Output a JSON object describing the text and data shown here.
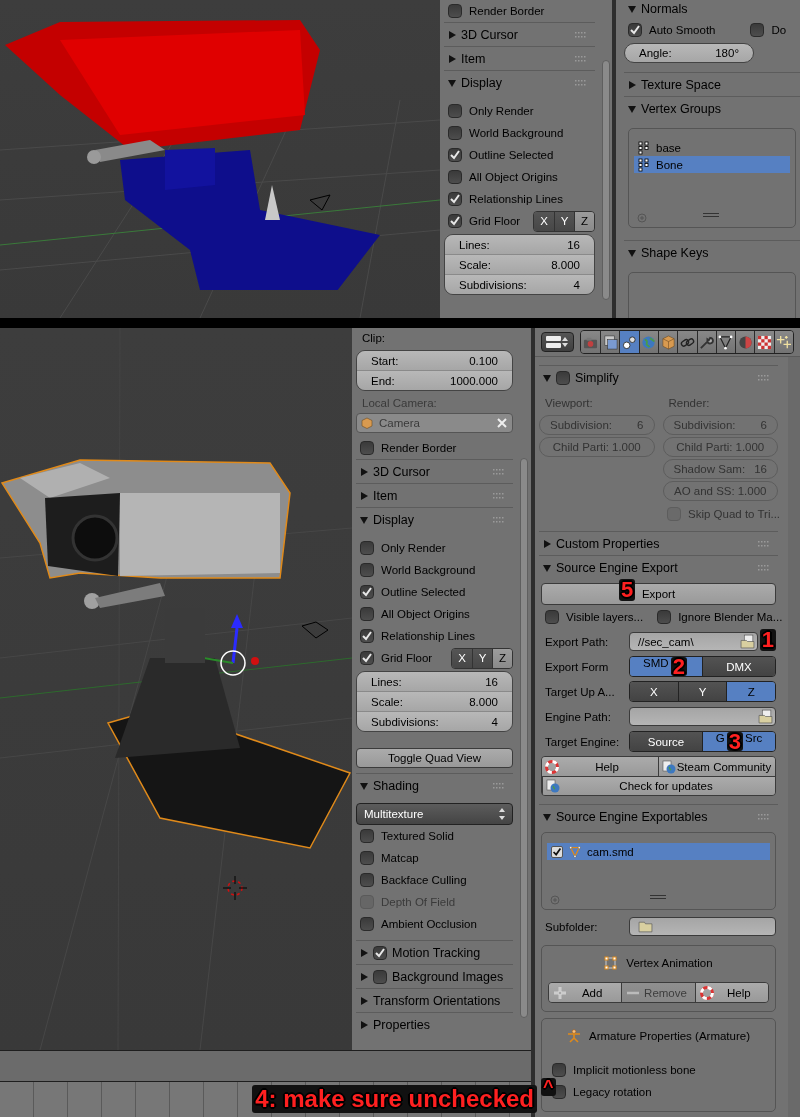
{
  "top": {
    "view_panel": {
      "render_border": {
        "label": "Render Border",
        "checked": false
      },
      "sections": [
        {
          "title": "3D Cursor",
          "expanded": false
        },
        {
          "title": "Item",
          "expanded": false
        },
        {
          "title": "Display",
          "expanded": true
        }
      ],
      "display_options": [
        {
          "label": "Only Render",
          "checked": false
        },
        {
          "label": "World Background",
          "checked": false
        },
        {
          "label": "Outline Selected",
          "checked": true
        },
        {
          "label": "All Object Origins",
          "checked": false
        },
        {
          "label": "Relationship Lines",
          "checked": true
        }
      ],
      "grid_floor": {
        "label": "Grid Floor",
        "checked": true,
        "axes": [
          {
            "label": "X",
            "selected": false
          },
          {
            "label": "Y",
            "selected": false
          },
          {
            "label": "Z",
            "selected": true
          }
        ]
      },
      "grid_fields": [
        {
          "label": "Lines:",
          "value": "16"
        },
        {
          "label": "Scale:",
          "value": "8.000"
        },
        {
          "label": "Subdivisions:",
          "value": "4"
        }
      ]
    },
    "data_panel": {
      "normals_title": "Normals",
      "auto_smooth": {
        "label": "Auto Smooth",
        "checked": true
      },
      "double_sided": {
        "label": "Do",
        "checked": false
      },
      "angle": {
        "label": "Angle:",
        "value": "180°"
      },
      "sections": [
        {
          "title": "Texture Space",
          "expanded": false
        },
        {
          "title": "Vertex Groups",
          "expanded": true
        }
      ],
      "vertex_groups": [
        {
          "name": "base",
          "selected": false
        },
        {
          "name": "Bone",
          "selected": true
        }
      ],
      "shape_keys": {
        "title": "Shape Keys",
        "expanded": true
      }
    }
  },
  "bottom": {
    "view_panel": {
      "clip": {
        "label": "Clip:",
        "fields": [
          {
            "label": "Start:",
            "value": "0.100"
          },
          {
            "label": "End:",
            "value": "1000.000"
          }
        ]
      },
      "local_camera": {
        "label": "Local Camera:",
        "value": "Camera",
        "disabled": true
      },
      "render_border": {
        "label": "Render Border",
        "checked": false
      },
      "sections": [
        {
          "title": "3D Cursor",
          "expanded": false
        },
        {
          "title": "Item",
          "expanded": false
        },
        {
          "title": "Display",
          "expanded": true
        }
      ],
      "display_options": [
        {
          "label": "Only Render",
          "checked": false
        },
        {
          "label": "World Background",
          "checked": false
        },
        {
          "label": "Outline Selected",
          "checked": true
        },
        {
          "label": "All Object Origins",
          "checked": false
        },
        {
          "label": "Relationship Lines",
          "checked": true
        }
      ],
      "grid_floor": {
        "label": "Grid Floor",
        "checked": true,
        "axes": [
          {
            "label": "X",
            "selected": false
          },
          {
            "label": "Y",
            "selected": false
          },
          {
            "label": "Z",
            "selected": true
          }
        ]
      },
      "grid_fields": [
        {
          "label": "Lines:",
          "value": "16"
        },
        {
          "label": "Scale:",
          "value": "8.000"
        },
        {
          "label": "Subdivisions:",
          "value": "4"
        }
      ],
      "toggle_quad_view": "Toggle Quad View",
      "shading": {
        "title": "Shading",
        "expanded": true,
        "mode": "Multitexture",
        "options": [
          {
            "label": "Textured Solid",
            "checked": false,
            "disabled": false
          },
          {
            "label": "Matcap",
            "checked": false,
            "disabled": false
          },
          {
            "label": "Backface Culling",
            "checked": false,
            "disabled": false
          },
          {
            "label": "Depth Of Field",
            "checked": false,
            "disabled": true
          },
          {
            "label": "Ambient Occlusion",
            "checked": false,
            "disabled": false
          }
        ]
      },
      "more_sections": [
        {
          "title": "Motion Tracking",
          "expanded": false,
          "kind": "checkbox",
          "checked": true
        },
        {
          "title": "Background Images",
          "expanded": false,
          "kind": "checkbox",
          "checked": false
        },
        {
          "title": "Transform Orientations",
          "expanded": false,
          "kind": "plain"
        },
        {
          "title": "Properties",
          "expanded": false,
          "kind": "plain"
        }
      ]
    },
    "properties": {
      "tabs": [
        {
          "selected": false
        },
        {
          "selected": false
        },
        {
          "selected": true
        },
        {
          "selected": false
        },
        {
          "selected": false
        },
        {
          "selected": false
        },
        {
          "selected": false
        },
        {
          "selected": false
        },
        {
          "selected": false
        },
        {
          "selected": false
        },
        {
          "selected": false
        }
      ],
      "simplify": {
        "title": "Simplify",
        "checked": false,
        "expanded": true,
        "disabled": true,
        "columns": [
          {
            "heading": "Viewport:",
            "fields": [
              {
                "label": "Subdivision:",
                "value": "6",
                "kind": "arrows"
              },
              {
                "label": "Child Parti:",
                "value": "1.000",
                "kind": "plain"
              }
            ]
          },
          {
            "heading": "Render:",
            "fields": [
              {
                "label": "Subdivision:",
                "value": "6",
                "kind": "arrows"
              },
              {
                "label": "Child Parti:",
                "value": "1.000",
                "kind": "plain"
              },
              {
                "label": "Shadow Sam:",
                "value": "16",
                "kind": "arrows"
              },
              {
                "label": "AO and SS:",
                "value": "1.000",
                "kind": "plain"
              }
            ]
          }
        ],
        "skip_quad": {
          "label": "Skip Quad to Tri...",
          "checked": false
        }
      },
      "custom_properties": {
        "title": "Custom Properties",
        "expanded": false
      },
      "export": {
        "title": "Source Engine Export",
        "expanded": true,
        "button": {
          "label": "Export",
          "annotation": "5"
        },
        "toggles": [
          {
            "label": "Visible layers...",
            "checked": false
          },
          {
            "label": "Ignore Blender Ma...",
            "checked": false
          }
        ],
        "export_path": {
          "label": "Export Path:",
          "value": "//sec_cam\\",
          "annotation": "1"
        },
        "export_form": {
          "label": "Export Form",
          "options": [
            {
              "label": "SMD",
              "selected": true,
              "annotation": "2"
            },
            {
              "label": "DMX",
              "selected": false
            }
          ]
        },
        "target_up": {
          "label": "Target Up A...",
          "options": [
            {
              "label": "X",
              "selected": false
            },
            {
              "label": "Y",
              "selected": false
            },
            {
              "label": "Z",
              "selected": true
            }
          ]
        },
        "engine_path": {
          "label": "Engine Path:"
        },
        "target_engine": {
          "label": "Target Engine:",
          "options": [
            {
              "label": "Source",
              "selected": false
            },
            {
              "label": "G",
              "label_end": "Src",
              "selected": true,
              "annotation": "3"
            }
          ]
        },
        "links": [
          {
            "label": "Help",
            "kind": "help"
          },
          {
            "label": "Steam Community",
            "kind": "web"
          }
        ],
        "updates": {
          "label": "Check for updates"
        }
      },
      "exportables": {
        "title": "Source Engine Exportables",
        "expanded": true,
        "items": [
          {
            "name": "cam.smd",
            "checked": true,
            "selected": true
          }
        ],
        "subfolder": {
          "label": "Subfolder:"
        },
        "vertex_animation": {
          "title": "Vertex Animation",
          "buttons": [
            {
              "label": "Add",
              "kind": "add",
              "disabled": false
            },
            {
              "label": "Remove",
              "kind": "remove",
              "disabled": true
            },
            {
              "label": "Help",
              "kind": "help",
              "disabled": false
            }
          ]
        },
        "armature": {
          "title": "Armature Properties (Armature)",
          "options": [
            {
              "label": "Implicit motionless bone",
              "checked": false
            },
            {
              "label": "Legacy rotation",
              "checked": false,
              "annotation": "^"
            }
          ]
        }
      }
    },
    "footer_note": "4:  make sure unchecked"
  }
}
